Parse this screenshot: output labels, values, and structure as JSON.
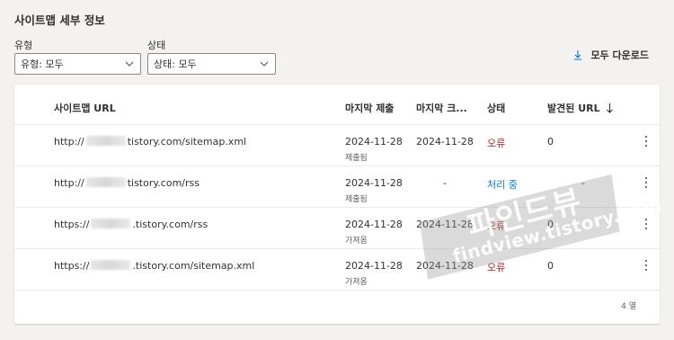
{
  "page": {
    "title": "사이트맵 세부 정보"
  },
  "filters": {
    "type": {
      "label": "유형",
      "value": "유형: 모두"
    },
    "status": {
      "label": "상태",
      "value": "상태: 모두"
    }
  },
  "toolbar": {
    "download_label": "모두 다운로드"
  },
  "table": {
    "columns": {
      "url": "사이트맵 URL",
      "last_submitted": "마지막 제출",
      "last_crawled": "마지막 크...",
      "status": "상태",
      "discovered": "발견된 URL",
      "sort_icon": "arrow-down-icon"
    },
    "rows": [
      {
        "url_prefix": "http://",
        "url_suffix": "tistory.com/sitemap.xml",
        "last_submitted": "2024-11-28",
        "submitted_note": "제출됨",
        "last_crawled": "2024-11-28",
        "status": "오류",
        "discovered": "0"
      },
      {
        "url_prefix": "http://",
        "url_suffix": "tistory.com/rss",
        "last_submitted": "2024-11-28",
        "submitted_note": "제출됨",
        "last_crawled": "-",
        "status": "처리 중",
        "discovered": "-"
      },
      {
        "url_prefix": "https://",
        "url_suffix": ".tistory.com/rss",
        "last_submitted": "2024-11-28",
        "submitted_note": "가져옴",
        "last_crawled": "2024-11-28",
        "status": "오류",
        "discovered": "0"
      },
      {
        "url_prefix": "https://",
        "url_suffix": ".tistory.com/sitemap.xml",
        "last_submitted": "2024-11-28",
        "submitted_note": "가져옴",
        "last_crawled": "2024-11-28",
        "status": "오류",
        "discovered": "0"
      }
    ],
    "row_count": "4 열"
  },
  "watermark": {
    "main": "파인드뷰",
    "sub": "findview.tistory.com"
  },
  "colors": {
    "error": "#a4262c",
    "processing": "#0078d4",
    "text": "#323130"
  }
}
